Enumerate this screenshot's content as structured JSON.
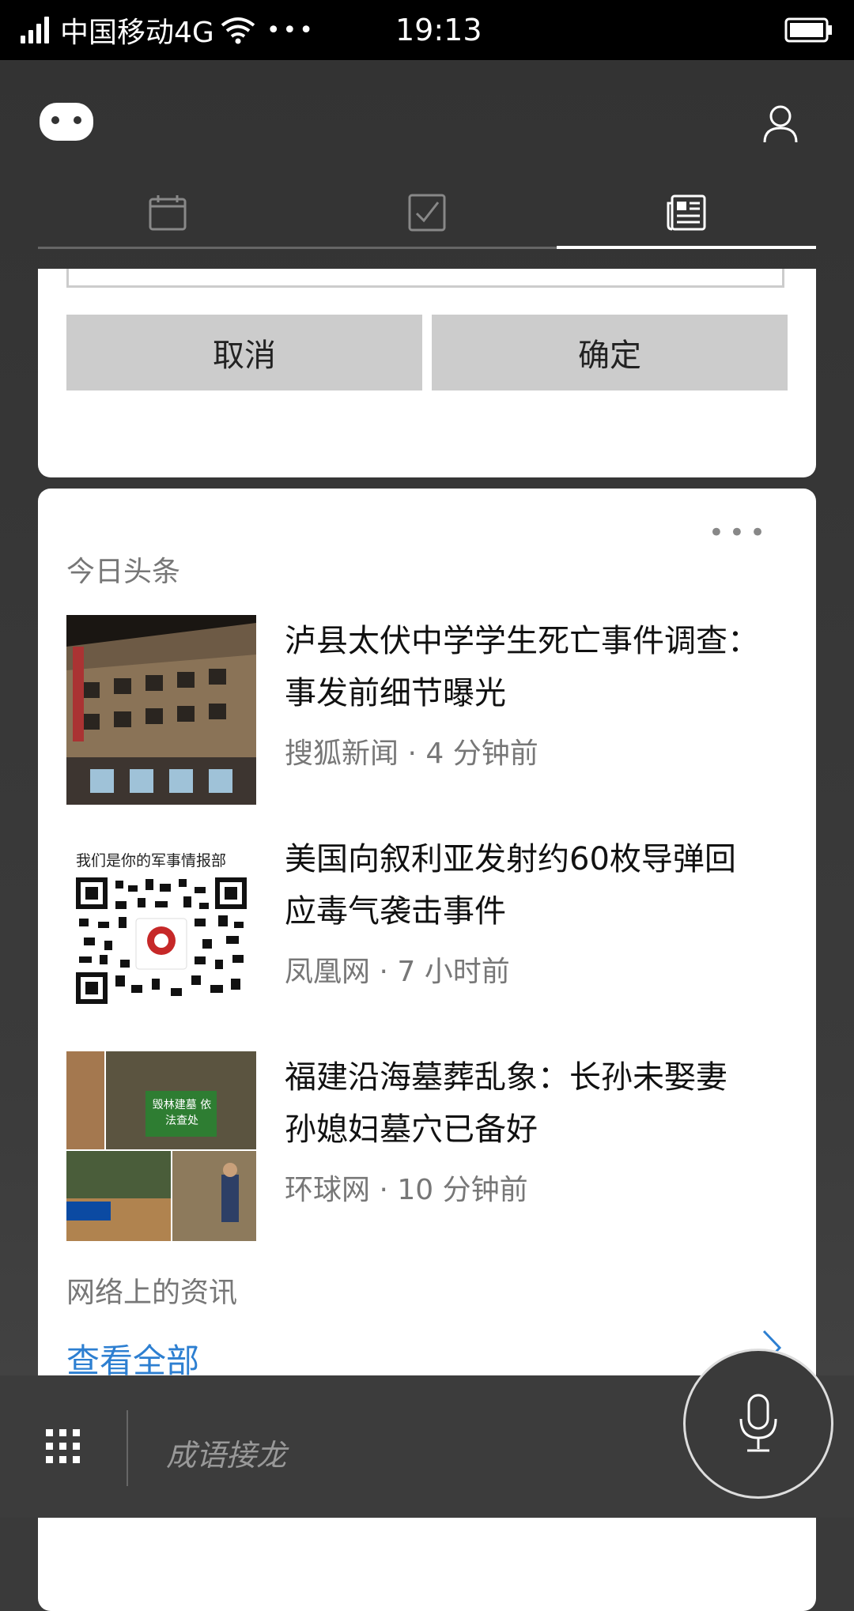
{
  "status_bar": {
    "carrier": "中国移动4G",
    "time": "19:13"
  },
  "dialog": {
    "cancel_label": "取消",
    "ok_label": "确定"
  },
  "news_card": {
    "title": "今日头条",
    "items": [
      {
        "headline": "泸县太伏中学学生死亡事件调查：事发前细节曝光",
        "source": "搜狐新闻",
        "time": "4 分钟前"
      },
      {
        "headline": "美国向叙利亚发射约60枚导弹回应毒气袭击事件",
        "source": "凤凰网",
        "time": "7 小时前",
        "thumb_text": "我们是你的军事情报部"
      },
      {
        "headline": "福建沿海墓葬乱象：长孙未娶妻 孙媳妇墓穴已备好",
        "source": "环球网",
        "time": "10 分钟前",
        "thumb_text": "毁林建墓 依法查处"
      }
    ],
    "footer_label": "网络上的资讯",
    "see_all": "查看全部"
  },
  "bottom_bar": {
    "suggestion": "成语接龙"
  },
  "colors": {
    "accent": "#2d7fd1",
    "background": "#3a3a3a"
  }
}
